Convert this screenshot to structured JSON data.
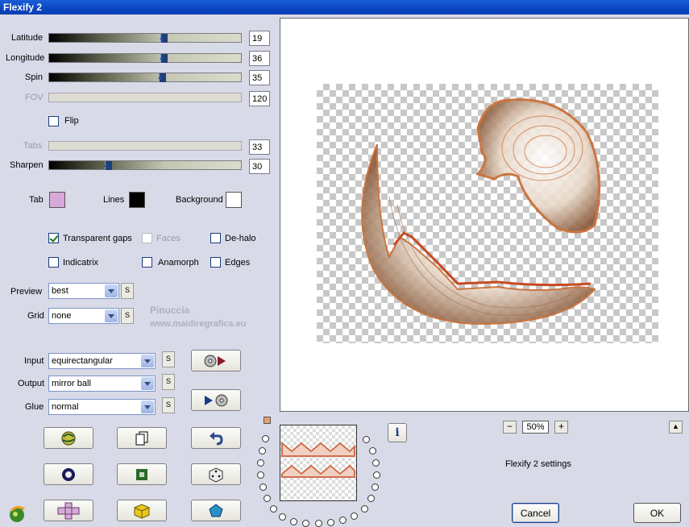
{
  "window": {
    "title": "Flexify 2"
  },
  "sliders": [
    {
      "label": "Latitude",
      "value": "19",
      "disabled": false
    },
    {
      "label": "Longitude",
      "value": "36",
      "disabled": false
    },
    {
      "label": "Spin",
      "value": "35",
      "disabled": false
    },
    {
      "label": "FOV",
      "value": "120",
      "disabled": true
    },
    {
      "label": "Tabs",
      "value": "33",
      "disabled": true
    },
    {
      "label": "Sharpen",
      "value": "30",
      "disabled": false
    }
  ],
  "flip": {
    "label": "Flip",
    "checked": false
  },
  "colors": {
    "tab": {
      "label": "Tab",
      "value": "#d7a9d8"
    },
    "lines": {
      "label": "Lines",
      "value": "#000000"
    },
    "background": {
      "label": "Background",
      "value": "#ffffff"
    }
  },
  "checkboxes": {
    "transparent_gaps": {
      "label": "Transparent gaps",
      "checked": true
    },
    "faces": {
      "label": "Faces",
      "checked": false
    },
    "de_halo": {
      "label": "De-halo",
      "checked": false
    },
    "indicatrix": {
      "label": "Indicatrix",
      "checked": false
    },
    "anamorph": {
      "label": "Anamorph",
      "checked": false
    },
    "edges": {
      "label": "Edges",
      "checked": false
    }
  },
  "preview_select": {
    "label": "Preview",
    "value": "best"
  },
  "grid_select": {
    "label": "Grid",
    "value": "none"
  },
  "input_select": {
    "label": "Input",
    "value": "equirectangular"
  },
  "output_select": {
    "label": "Output",
    "value": "mirror ball"
  },
  "glue_select": {
    "label": "Glue",
    "value": "normal"
  },
  "s_label": "S",
  "watermark": {
    "name": "Pinuccia",
    "url": "www.maidiregrafica.eu"
  },
  "zoom": {
    "value": "50%",
    "minus": "−",
    "plus": "+"
  },
  "info_label": "i",
  "status_text": "Flexify 2 settings",
  "buttons": {
    "cancel": "Cancel",
    "ok": "OK"
  },
  "icons": {
    "toolbar": [
      "globe-icon",
      "copy-icon",
      "undo-icon",
      "ring-icon",
      "square-frame-icon",
      "dice-icon",
      "cross-tile-icon",
      "cube-icon",
      "pentagon-icon"
    ],
    "logo": "flexify-logo-icon"
  }
}
